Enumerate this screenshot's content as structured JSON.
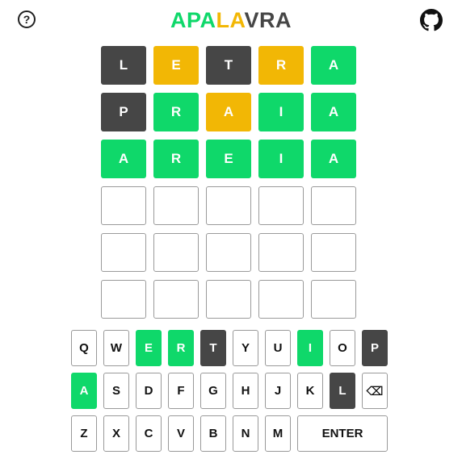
{
  "header": {
    "title_parts": [
      {
        "text": "A",
        "color": "#0fd86a"
      },
      {
        "text": "P",
        "color": "#0fd86a"
      },
      {
        "text": "A",
        "color": "#0fd86a"
      },
      {
        "text": "L",
        "color": "#f2b705"
      },
      {
        "text": "A",
        "color": "#f2b705"
      },
      {
        "text": "V",
        "color": "#464646"
      },
      {
        "text": "R",
        "color": "#464646"
      },
      {
        "text": "A",
        "color": "#464646"
      }
    ],
    "help_icon": "?",
    "github_icon": "github-icon"
  },
  "board": [
    [
      {
        "letter": "L",
        "state": "absent"
      },
      {
        "letter": "E",
        "state": "present"
      },
      {
        "letter": "T",
        "state": "absent"
      },
      {
        "letter": "R",
        "state": "present"
      },
      {
        "letter": "A",
        "state": "correct"
      }
    ],
    [
      {
        "letter": "P",
        "state": "absent"
      },
      {
        "letter": "R",
        "state": "correct"
      },
      {
        "letter": "A",
        "state": "present"
      },
      {
        "letter": "I",
        "state": "correct"
      },
      {
        "letter": "A",
        "state": "correct"
      }
    ],
    [
      {
        "letter": "A",
        "state": "correct"
      },
      {
        "letter": "R",
        "state": "correct"
      },
      {
        "letter": "E",
        "state": "correct"
      },
      {
        "letter": "I",
        "state": "correct"
      },
      {
        "letter": "A",
        "state": "correct"
      }
    ],
    [
      {
        "letter": "",
        "state": "empty"
      },
      {
        "letter": "",
        "state": "empty"
      },
      {
        "letter": "",
        "state": "empty"
      },
      {
        "letter": "",
        "state": "empty"
      },
      {
        "letter": "",
        "state": "empty"
      }
    ],
    [
      {
        "letter": "",
        "state": "empty"
      },
      {
        "letter": "",
        "state": "empty"
      },
      {
        "letter": "",
        "state": "empty"
      },
      {
        "letter": "",
        "state": "empty"
      },
      {
        "letter": "",
        "state": "empty"
      }
    ],
    [
      {
        "letter": "",
        "state": "empty"
      },
      {
        "letter": "",
        "state": "empty"
      },
      {
        "letter": "",
        "state": "empty"
      },
      {
        "letter": "",
        "state": "empty"
      },
      {
        "letter": "",
        "state": "empty"
      }
    ]
  ],
  "keyboard": [
    [
      {
        "label": "Q",
        "state": ""
      },
      {
        "label": "W",
        "state": ""
      },
      {
        "label": "E",
        "state": "correct"
      },
      {
        "label": "R",
        "state": "correct"
      },
      {
        "label": "T",
        "state": "absent"
      },
      {
        "label": "Y",
        "state": ""
      },
      {
        "label": "U",
        "state": ""
      },
      {
        "label": "I",
        "state": "correct"
      },
      {
        "label": "O",
        "state": ""
      },
      {
        "label": "P",
        "state": "absent"
      }
    ],
    [
      {
        "label": "A",
        "state": "correct"
      },
      {
        "label": "S",
        "state": ""
      },
      {
        "label": "D",
        "state": ""
      },
      {
        "label": "F",
        "state": ""
      },
      {
        "label": "G",
        "state": ""
      },
      {
        "label": "H",
        "state": ""
      },
      {
        "label": "J",
        "state": ""
      },
      {
        "label": "K",
        "state": ""
      },
      {
        "label": "L",
        "state": "absent"
      },
      {
        "label": "⌫",
        "state": "",
        "name": "backspace"
      }
    ],
    [
      {
        "label": "Z",
        "state": ""
      },
      {
        "label": "X",
        "state": ""
      },
      {
        "label": "C",
        "state": ""
      },
      {
        "label": "V",
        "state": ""
      },
      {
        "label": "B",
        "state": ""
      },
      {
        "label": "N",
        "state": ""
      },
      {
        "label": "M",
        "state": ""
      },
      {
        "label": "ENTER",
        "state": "",
        "wide": true,
        "name": "enter"
      }
    ]
  ]
}
